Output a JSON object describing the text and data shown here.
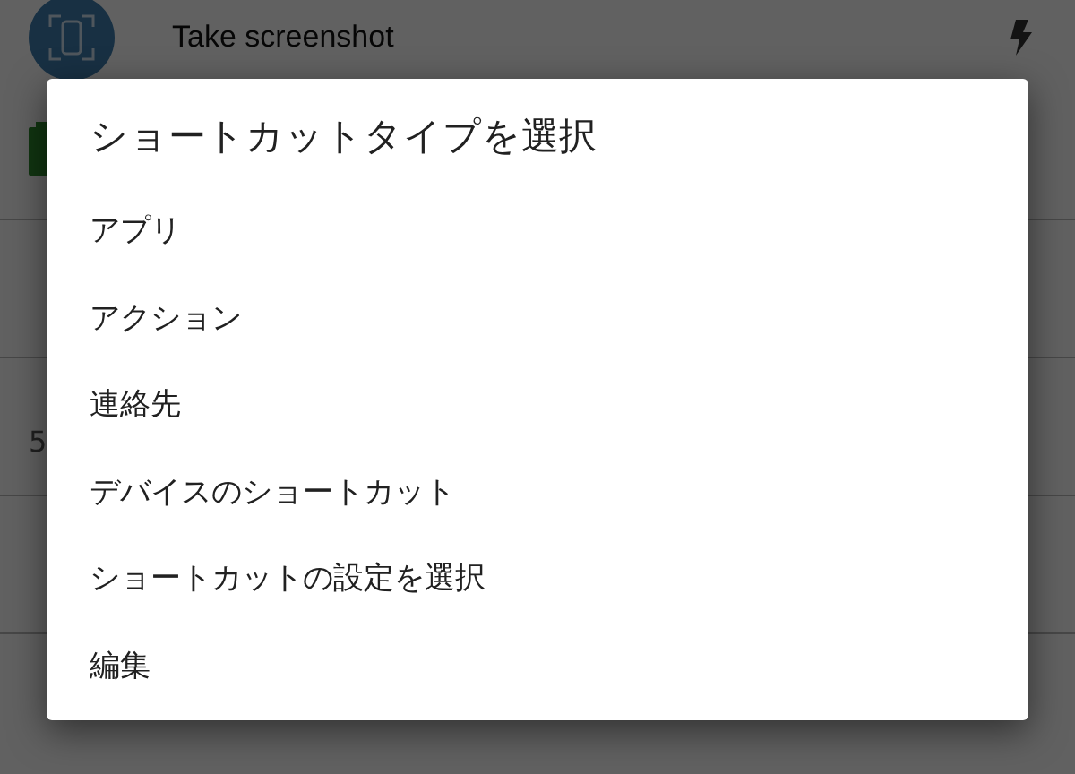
{
  "background": {
    "top_item": {
      "title": "Take screenshot"
    },
    "partial_value": "5"
  },
  "dialog": {
    "title": "ショートカットタイプを選択",
    "options": [
      "アプリ",
      "アクション",
      "連絡先",
      "デバイスのショートカット",
      "ショートカットの設定を選択",
      "編集"
    ]
  }
}
